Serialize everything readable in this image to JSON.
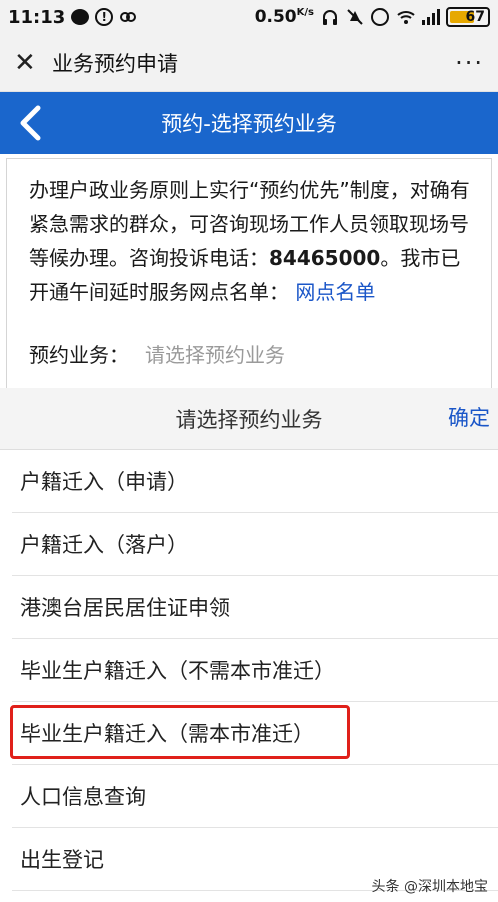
{
  "status_bar": {
    "time": "11:13",
    "speed": "0.50",
    "speed_unit": "K/s",
    "network": "4G",
    "battery": "67",
    "battery_level": 0.67
  },
  "title_bar": {
    "title": "业务预约申请",
    "close_icon": "close-icon",
    "more_icon": "more-icon"
  },
  "header": {
    "title": "预约-选择预约业务",
    "back_icon": "chevron-left-icon"
  },
  "notice": {
    "text_1": "办理户政业务原则上实行“预约优先”制度，对确有紧急需求的群众，可咨询现场工作人员领取现场号等候办理。咨询投诉电话：",
    "phone": "84465000",
    "text_2": "。我市已开通午间延时服务网点名单：",
    "link": "网点名单"
  },
  "appointment": {
    "label": "预约业务：",
    "placeholder": "请选择预约业务"
  },
  "picker": {
    "title": "请选择预约业务",
    "confirm": "确定",
    "options": [
      "户籍迁入（申请）",
      "户籍迁入（落户）",
      "港澳台居民居住证申领",
      "毕业生户籍迁入（不需本市准迁）",
      "毕业生户籍迁入（需本市准迁）",
      "人口信息查询",
      "出生登记"
    ],
    "highlight_color": "#e0201a"
  },
  "watermark": {
    "text": "头条 @深圳本地宝"
  },
  "colors": {
    "header_blue": "#1a66cc",
    "link_blue": "#1a56c8",
    "battery": "#e6a800"
  }
}
